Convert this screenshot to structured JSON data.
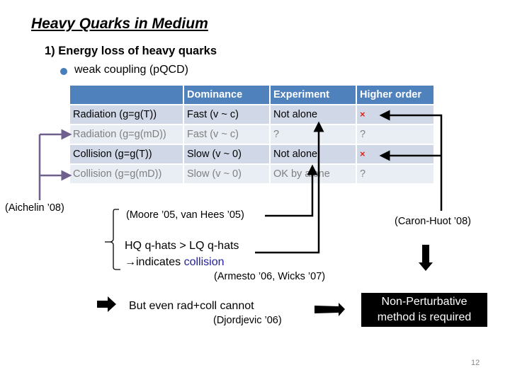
{
  "slide": {
    "title": "Heavy Quarks in Medium",
    "subtitle": "1) Energy loss of heavy quarks",
    "bullet": "weak coupling (pQCD)",
    "page_number": "12"
  },
  "table": {
    "headers": [
      "",
      "Dominance",
      "Experiment",
      "Higher order"
    ],
    "rows": [
      {
        "style": "dark",
        "cells": [
          "Radiation (g=g(T))",
          "Fast (v ~ c)",
          "Not alone",
          "×"
        ]
      },
      {
        "style": "light",
        "cells": [
          "Radiation (g=g(mD))",
          "Fast (v ~ c)",
          "?",
          "?"
        ]
      },
      {
        "style": "dark",
        "cells": [
          "Collision (g=g(T))",
          "Slow (v ~ 0)",
          "Not alone",
          "×"
        ]
      },
      {
        "style": "light",
        "cells": [
          "Collision (g=g(mD))",
          "Slow (v ~ 0)",
          "OK by alone",
          "?"
        ]
      }
    ]
  },
  "references": {
    "aichelin": "(Aichelin ’08)",
    "moore": "(Moore ’05, van Hees ’05)",
    "caron_huot": "(Caron-Huot ’08)",
    "armesto": "(Armesto ’06, Wicks ’07)",
    "djordjevic": "(Djordjevic ’06)"
  },
  "notes": {
    "hq_line1": "HQ q-hats > LQ q-hats",
    "hq_line2_prefix": "→indicates ",
    "hq_line2_highlight": "collision",
    "but_even": "But even rad+coll cannot",
    "conclusion_line1": "Non-Perturbative",
    "conclusion_line2": "method is required"
  },
  "colors": {
    "header_blue": "#4f81bd",
    "row_dark": "#d0d8e8",
    "row_light": "#e9edf4",
    "bullet_blue": "#4a7ebb",
    "bracket_purple": "#6e5f8c",
    "x_red": "#d9261c",
    "highlight_blue": "#1f1f9a"
  }
}
